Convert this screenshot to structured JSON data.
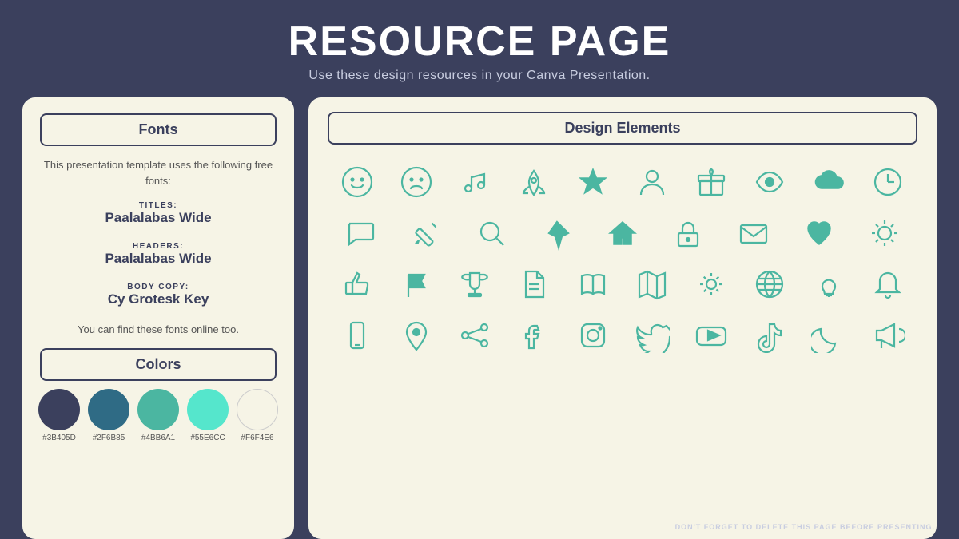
{
  "header": {
    "title": "RESOURCE PAGE",
    "subtitle": "Use these design resources in your Canva Presentation."
  },
  "left_panel": {
    "fonts_heading": "Fonts",
    "fonts_desc": "This presentation template uses the following free fonts:",
    "font_entries": [
      {
        "label": "TITLES:",
        "name": "Paalalabas Wide"
      },
      {
        "label": "HEADERS:",
        "name": "Paalalabas Wide"
      },
      {
        "label": "BODY COPY:",
        "name": "Cy Grotesk Key"
      }
    ],
    "fonts_find": "You can find these fonts online too.",
    "colors_heading": "Colors",
    "swatches": [
      {
        "color": "#3B405D",
        "label": "#3B405D"
      },
      {
        "color": "#2F6B85",
        "label": "#2F6B85"
      },
      {
        "color": "#4BB6A1",
        "label": "#4BB6A1"
      },
      {
        "color": "#55E6CC",
        "label": "#55E6CC"
      },
      {
        "color": "#F6F4E6",
        "label": "#F6F4E6"
      }
    ]
  },
  "right_panel": {
    "heading": "Design Elements"
  },
  "footer": {
    "note": "DON'T FORGET TO DELETE THIS PAGE BEFORE PRESENTING."
  }
}
